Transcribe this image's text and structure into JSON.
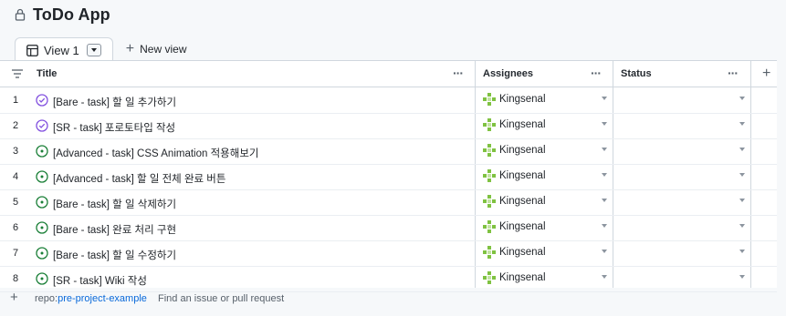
{
  "app": {
    "title": "ToDo App"
  },
  "tabs": {
    "active": "View 1",
    "new_view": "New view"
  },
  "columns": {
    "title": "Title",
    "assignees": "Assignees",
    "status": "Status",
    "add": "+"
  },
  "rows": [
    {
      "num": "1",
      "title": "[Bare - task] 할 일 추가하기",
      "state": "closed",
      "assignee": "Kingsenal",
      "status": ""
    },
    {
      "num": "2",
      "title": "[SR - task] 포로토타입 작성",
      "state": "closed",
      "assignee": "Kingsenal",
      "status": ""
    },
    {
      "num": "3",
      "title": "[Advanced - task] CSS Animation 적용해보기",
      "state": "open",
      "assignee": "Kingsenal",
      "status": ""
    },
    {
      "num": "4",
      "title": "[Advanced - task] 할 일 전체 완료 버튼",
      "state": "open",
      "assignee": "Kingsenal",
      "status": ""
    },
    {
      "num": "5",
      "title": "[Bare - task] 할 일 삭제하기",
      "state": "open",
      "assignee": "Kingsenal",
      "status": ""
    },
    {
      "num": "6",
      "title": "[Bare - task] 완료 처리 구현",
      "state": "open",
      "assignee": "Kingsenal",
      "status": ""
    },
    {
      "num": "7",
      "title": "[Bare - task] 할 일 수정하기",
      "state": "open",
      "assignee": "Kingsenal",
      "status": ""
    },
    {
      "num": "8",
      "title": "[SR - task] Wiki 작성",
      "state": "open",
      "assignee": "Kingsenal",
      "status": ""
    }
  ],
  "footer": {
    "add": "+",
    "repo_prefix": "repo:",
    "repo_name": "pre-project-example",
    "placeholder": "Find an issue or pull request"
  },
  "colors": {
    "open": "#1a7f37",
    "closed": "#8250df",
    "link": "#0969da",
    "avatar": "#7fc241"
  }
}
